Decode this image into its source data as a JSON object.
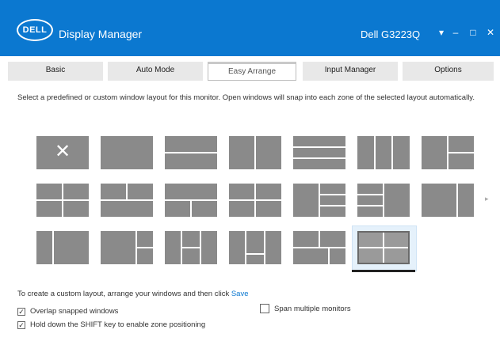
{
  "titlebar": {
    "logo_text": "DELL",
    "app_title": "Display Manager",
    "monitor": "Dell G3223Q",
    "btn_dropdown": "▾",
    "btn_minimize": "–",
    "btn_restore": "□",
    "btn_close": "✕",
    "accent": "#0b78d0"
  },
  "tabs": [
    {
      "label": "Basic"
    },
    {
      "label": "Auto Mode"
    },
    {
      "label": "Easy Arrange"
    },
    {
      "label": "Input Manager"
    },
    {
      "label": "Options"
    }
  ],
  "active_tab": "Easy Arrange",
  "main": {
    "description": "Select a predefined or custom window layout for this monitor. Open windows will snap into each zone of the selected layout automatically.",
    "arrow": "▸",
    "close_icon": "✕"
  },
  "footer": {
    "custom_text": "To create a custom layout, arrange your windows and then click",
    "custom_link": "Save",
    "option1": "Overlap snapped windows",
    "option2": "Hold down the SHIFT key to enable zone positioning",
    "option3": "Span multiple monitors",
    "option1_checked": true,
    "option2_checked": true,
    "option3_checked": false
  }
}
